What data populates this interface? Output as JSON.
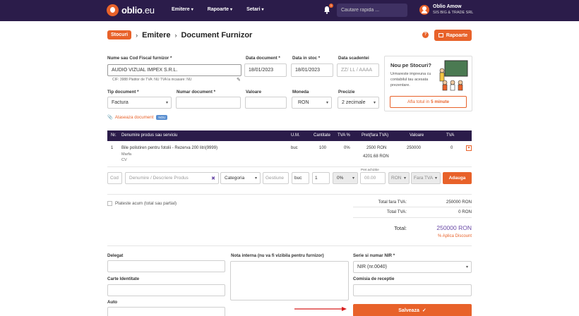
{
  "nav": {
    "logo_main": "oblio",
    "logo_tld": ".eu",
    "menu": [
      "Emitere",
      "Rapoarte",
      "Setari"
    ],
    "notifications": "1",
    "search_placeholder": "Cautare rapida ...",
    "user_name": "Oblio Amow",
    "user_company": "SIS BIG & TRADE SRL"
  },
  "breadcrumb": {
    "root": "Stocuri",
    "level1": "Emitere",
    "level2": "Document Furnizor",
    "reports_button": "Rapoarte"
  },
  "form": {
    "supplier_label": "Nume sau Cod Fiscal furnizor *",
    "supplier_value": "AUDIO VIZUAL IMPEX S.R.L.",
    "supplier_meta": "CIF: 3988   Platitor de TVA: NU   TVA la incasare: NU",
    "doc_date_label": "Data document *",
    "doc_date_value": "18/01/2023",
    "stock_date_label": "Data in stoc *",
    "stock_date_value": "18/01/2023",
    "due_date_label": "Data scadentei",
    "due_date_placeholder": "ZZ/ LL / AAAA",
    "doc_type_label": "Tip document *",
    "doc_type_value": "Factura",
    "doc_number_label": "Numar document *",
    "value_label": "Valoare",
    "currency_label": "Moneda",
    "currency_value": "RON",
    "precision_label": "Precizie",
    "precision_value": "2 zecimale",
    "attach_label": "Ataseaza document",
    "attach_badge": "NOU"
  },
  "promo": {
    "title": "Nou pe Stocuri?",
    "description": "Urmareste impreuna cu contabilul tau acesata prezentare.",
    "button_prefix": "Afla totul in",
    "button_bold": "5 minute"
  },
  "table": {
    "headers": [
      "Nr.",
      "Denumire produs sau serviciu",
      "U.M.",
      "Cantitate",
      "TVA %",
      "Pret(fara TVA)",
      "Valoare",
      "TVA"
    ],
    "rows": [
      {
        "nr": "1",
        "name": "Bile polistiren pentru fotolii - Rezerva 200 litri(9999)",
        "sub1": "Marfa",
        "sub2": "CV",
        "um": "buc",
        "qty": "100",
        "tva_pct": "0%",
        "price": "2500 RON",
        "price2": "4201.68 RON",
        "value": "250000",
        "tva": "0"
      }
    ]
  },
  "add_row": {
    "cod": "Cod",
    "name_placeholder": "Denumire / Descriere Produs",
    "category": "Categoria",
    "gestiune": "Gestiune",
    "um": "buc",
    "qty": "1",
    "tva": "0%",
    "price_label": "Pret achizitie",
    "price_placeholder": "00.00",
    "currency": "RON",
    "fara_tva": "Fara TVA",
    "add_button": "Adauga"
  },
  "pay_now_label": "Plateste acum (total sau partial)",
  "totals": {
    "no_vat_label": "Total fara TVA:",
    "no_vat_value": "250000 RON",
    "vat_label": "Total TVA:",
    "vat_value": "0 RON",
    "total_label": "Total:",
    "total_value": "250000 RON",
    "discount": "% Aplica Discount"
  },
  "footer": {
    "delegate_label": "Delegat",
    "id_card_label": "Carte Identitate",
    "auto_label": "Auto",
    "internal_note_label": "Nota interna (nu va fi vizibila pentru furnizor)",
    "series_label": "Serie si numar NIR *",
    "series_value": "NIR (nr.0040)",
    "commission_label": "Comisia de receptie",
    "save_button": "Salveaza"
  }
}
